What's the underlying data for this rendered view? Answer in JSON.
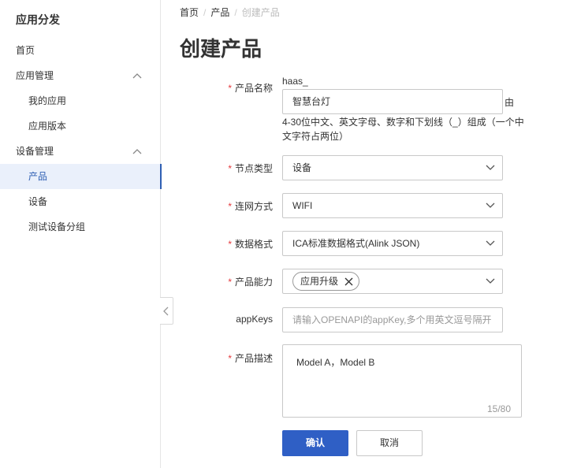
{
  "sidebar": {
    "title": "应用分发",
    "items": [
      {
        "label": "首页"
      },
      {
        "label": "应用管理"
      },
      {
        "label": "我的应用"
      },
      {
        "label": "应用版本"
      },
      {
        "label": "设备管理"
      },
      {
        "label": "产品"
      },
      {
        "label": "设备"
      },
      {
        "label": "测试设备分组"
      }
    ]
  },
  "breadcrumb": {
    "home": "首页",
    "product": "产品",
    "current": "创建产品",
    "separator": "/"
  },
  "page": {
    "title": "创建产品"
  },
  "form": {
    "required_mark": "*",
    "product_name": {
      "label": "产品名称",
      "prefix": "haas_",
      "value": "智慧台灯",
      "tail": "由",
      "help": "4-30位中文、英文字母、数字和下划线（_）组成（一个中文字符占两位）"
    },
    "node_type": {
      "label": "节点类型",
      "value": "设备"
    },
    "network": {
      "label": "连网方式",
      "value": "WIFI"
    },
    "data_format": {
      "label": "数据格式",
      "value": "ICA标准数据格式(Alink JSON)"
    },
    "capability": {
      "label": "产品能力",
      "tag": "应用升级"
    },
    "appkeys": {
      "label": "appKeys",
      "placeholder": "请输入OPENAPI的appKey,多个用英文逗号隔开"
    },
    "description": {
      "label": "产品描述",
      "value": "Model A，Model B",
      "counter": "15/80"
    }
  },
  "buttons": {
    "confirm": "确认",
    "cancel": "取消"
  },
  "colors": {
    "accent": "#2f5fc5",
    "required": "#e4393c",
    "active_bg": "#eaf0fb"
  }
}
